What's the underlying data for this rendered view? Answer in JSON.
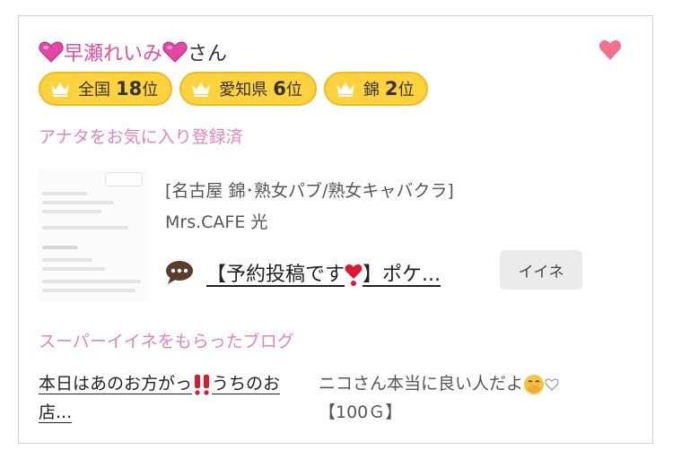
{
  "profile": {
    "name": "早瀬れいみ",
    "suffix": "さん",
    "favorite_status": "アナタをお気に入り登録済"
  },
  "badges": [
    {
      "label": "全国",
      "rank": "18",
      "unit": "位"
    },
    {
      "label": "愛知県",
      "rank": "6",
      "unit": "位"
    },
    {
      "label": "錦",
      "rank": "2",
      "unit": "位"
    }
  ],
  "shop": {
    "category": "[名古屋 錦･熟女パブ/熟女キャバクラ]",
    "name": "Mrs.CAFE 光"
  },
  "blog": {
    "title_before": "【予約投稿です",
    "title_after": "】ポケ...",
    "iine_label": "イイネ"
  },
  "super": {
    "section_label": "スーパーイイネをもらったブログ",
    "title_before": "本日はあのお方がっ",
    "title_after": "うちのお店...",
    "comment_text": "ニコさん本当に良い人だよ",
    "comment_price": "【100Ｇ】"
  },
  "colors": {
    "pink": "#e2519c",
    "label_pink": "#e384b9",
    "badge": "#fdd23c",
    "heart": "#f2708e"
  },
  "icons": {
    "name_decoration": "pink-heart-emoji",
    "favorite": "heart-icon",
    "badge": "crown-icon",
    "blog": "speech-bubble-icon",
    "heart_exclamation": "heart-exclamation-emoji",
    "double_exclamation": "double-exclamation-emoji",
    "hand_over_mouth": "hand-over-mouth-emoji"
  }
}
